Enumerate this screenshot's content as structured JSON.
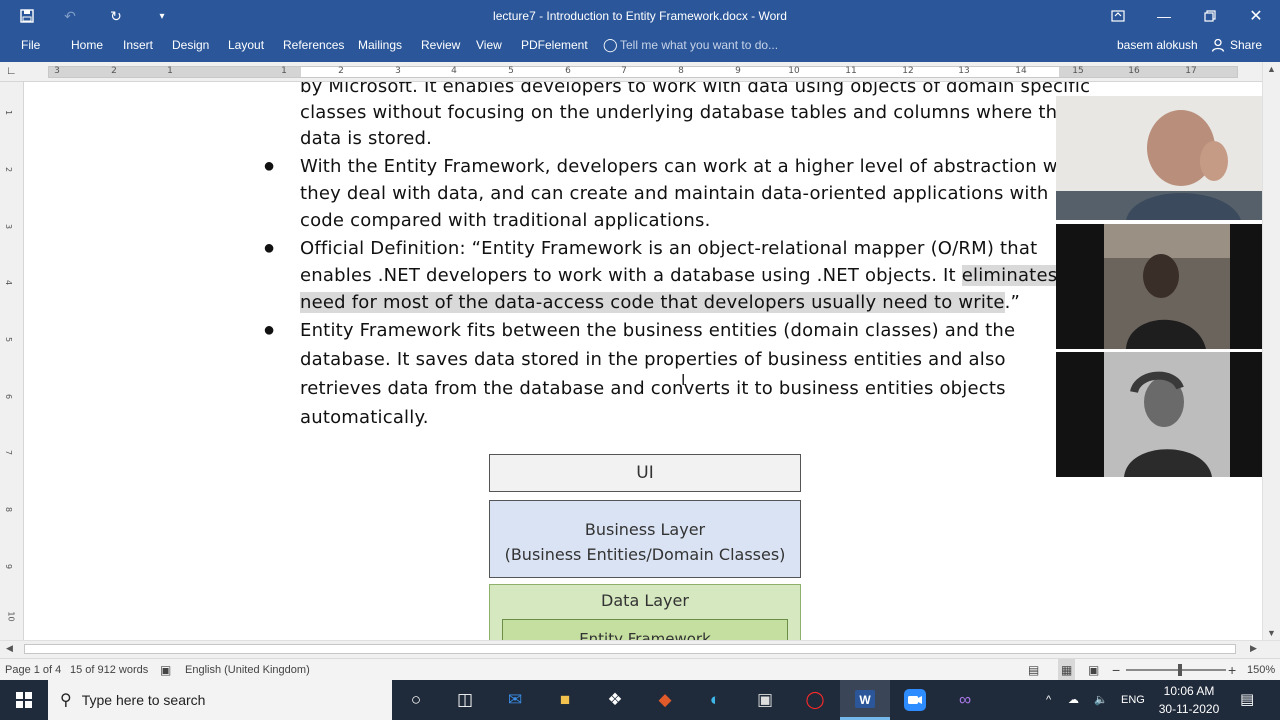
{
  "app": {
    "title": "lecture7 - Introduction to Entity Framework.docx - Word"
  },
  "ribbon": {
    "tabs": [
      "File",
      "Home",
      "Insert",
      "Design",
      "Layout",
      "References",
      "Mailings",
      "Review",
      "View",
      "PDFelement"
    ],
    "tell_me": "Tell me what you want to do...",
    "user": "basem alokush",
    "share": "Share"
  },
  "ruler": {
    "numbers": [
      "3",
      "2",
      "1",
      "1",
      "2",
      "3",
      "4",
      "5",
      "6",
      "7",
      "8",
      "9",
      "10",
      "11",
      "12",
      "13",
      "14",
      "15",
      "16",
      "17"
    ],
    "vnumbers": [
      "1",
      "2",
      "3",
      "4",
      "5",
      "6",
      "7",
      "8",
      "9",
      "10",
      "11"
    ]
  },
  "document": {
    "lines": [
      {
        "text": "by Microsoft. It enables developers to work with data using objects of domain specific"
      },
      {
        "text": "classes without focusing on the underlying database tables and columns where this"
      },
      {
        "text": "data is stored."
      },
      {
        "text": "With the Entity Framework, developers can work at a higher level of abstraction when"
      },
      {
        "text": "they deal with data, and can create and maintain data-oriented applications with less"
      },
      {
        "text": "code compared with traditional applications."
      },
      {
        "text": "Official Definition: “Entity Framework is an object-relational mapper (O/RM) that"
      },
      {
        "text_a": "enables .NET developers to work with a database using .NET objects. It ",
        "text_b": "eliminates the"
      },
      {
        "text_a": "need for most of the data-access code that developers usually need to write",
        "text_b": ".”"
      },
      {
        "text": "Entity Framework fits between the business entities (domain classes) and the"
      },
      {
        "text": "database. It saves data stored in the properties of business entities and also"
      },
      {
        "text": "retrieves data from the database and converts it to business entities objects"
      },
      {
        "text": "automatically."
      }
    ],
    "bullet": "●"
  },
  "diagram": {
    "ui": "UI",
    "business_line1": "Business Layer",
    "business_line2": "(Business Entities/Domain Classes)",
    "data_layer": "Data Layer",
    "entity_framework": "Entity Framework"
  },
  "status": {
    "page": "Page 1 of 4",
    "words": "15 of 912 words",
    "language": "English (United Kingdom)",
    "zoom": "150%"
  },
  "taskbar": {
    "search_placeholder": "Type here to search",
    "language": "ENG",
    "time": "10:06 AM",
    "date": "30-11-2020"
  },
  "colors": {
    "titlebar": "#2b579a",
    "highlight": "#d9d9d9",
    "business_layer": "#dae3f3",
    "data_layer": "#d5e8c0",
    "taskbar": "#1f2a3a"
  }
}
